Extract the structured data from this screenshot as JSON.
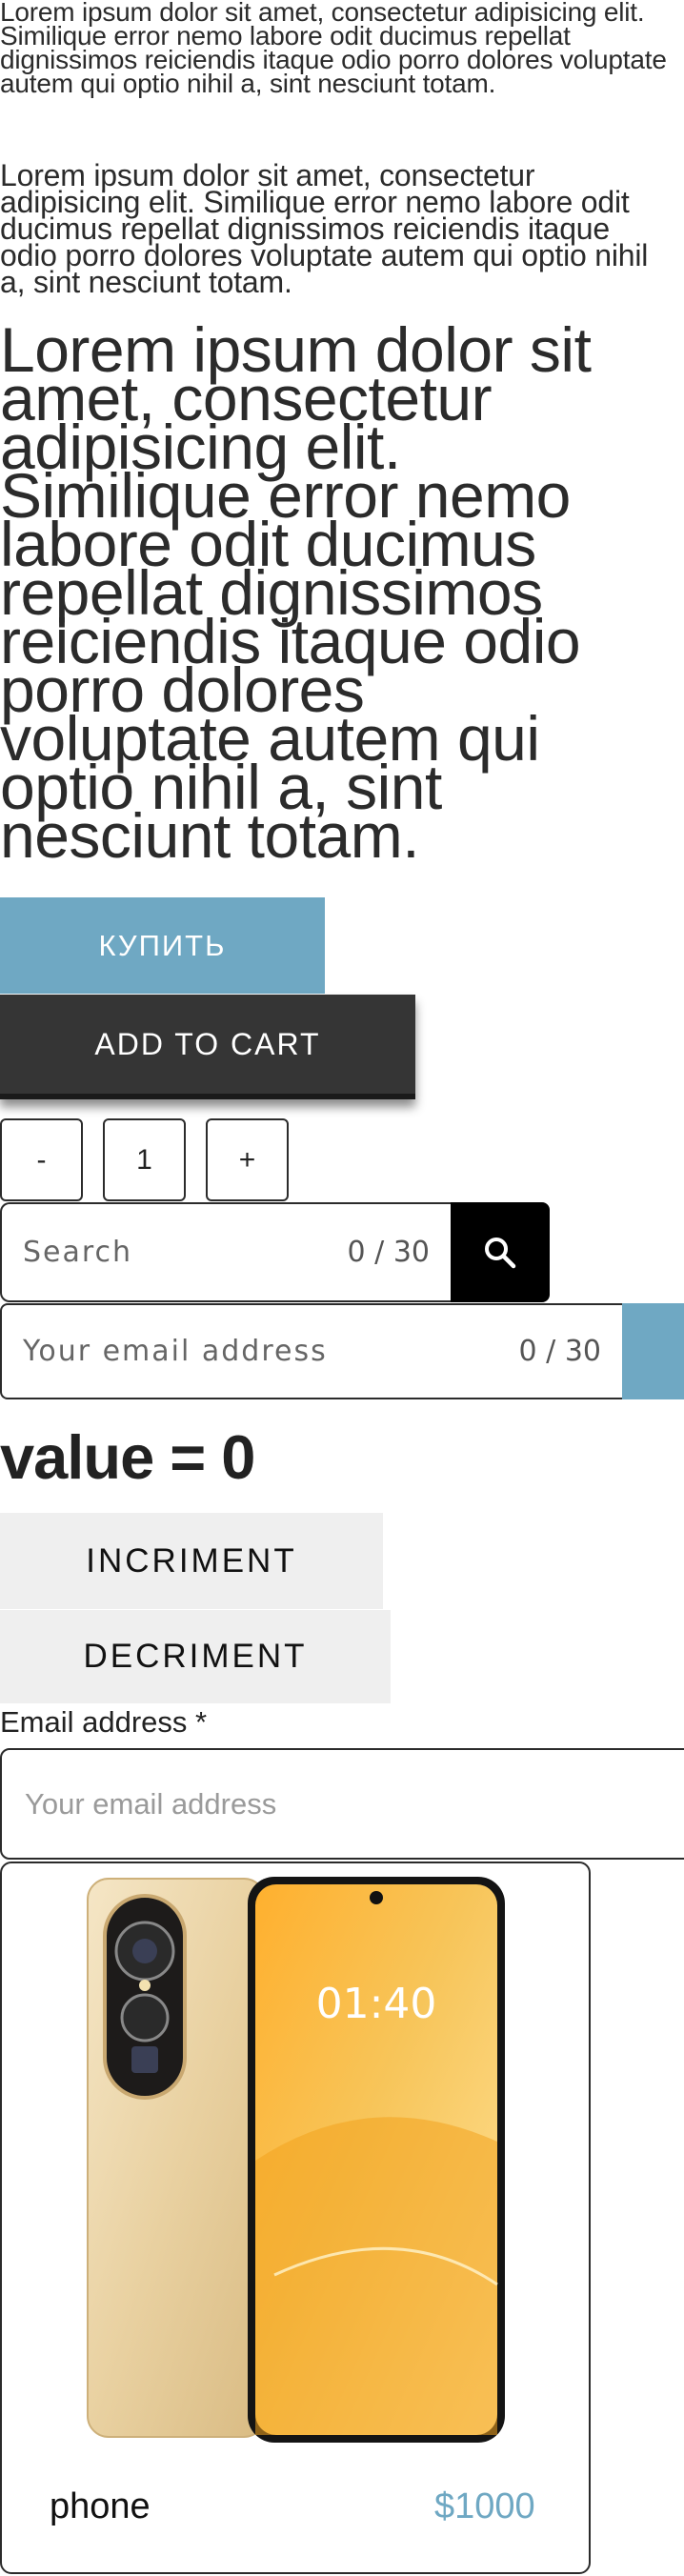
{
  "paragraphs": {
    "small": "Lorem ipsum dolor sit amet, consectetur adipisicing elit. Similique error nemo labore odit ducimus repellat dignissimos reiciendis itaque odio porro dolores voluptate autem qui optio nihil a, sint nesciunt totam.",
    "medium": "Lorem ipsum dolor sit amet, consectetur adipisicing elit. Similique error nemo labore odit ducimus repellat dignissimos reiciendis itaque odio porro dolores voluptate autem qui optio nihil a, sint nesciunt totam.",
    "large": "Lorem ipsum dolor sit amet, consectetur adipisicing elit. Similique error nemo labore odit ducimus repellat dignissimos reiciendis itaque odio porro dolores voluptate autem qui optio nihil a, sint nesciunt totam."
  },
  "buttons": {
    "buy_label": "КУПИТЬ",
    "add_to_cart_label": "ADD TO CART",
    "increment_label": "INCRIMENT",
    "decrement_label": "DECRIMENT"
  },
  "quantity": {
    "minus": "-",
    "value": "1",
    "plus": "+"
  },
  "search": {
    "placeholder": "Search",
    "counter": "0 / 30",
    "icon": "search-icon"
  },
  "subscribe": {
    "placeholder": "Your email address",
    "counter": "0 / 30"
  },
  "counter_display": "value = 0",
  "email_form": {
    "label": "Email address *",
    "placeholder": "Your email address"
  },
  "product": {
    "title": "phone",
    "price": "$1000",
    "screen_time": "01:40"
  },
  "colors": {
    "accent": "#6fa8c3",
    "dark_button": "#353535",
    "light_button": "#efefef"
  }
}
